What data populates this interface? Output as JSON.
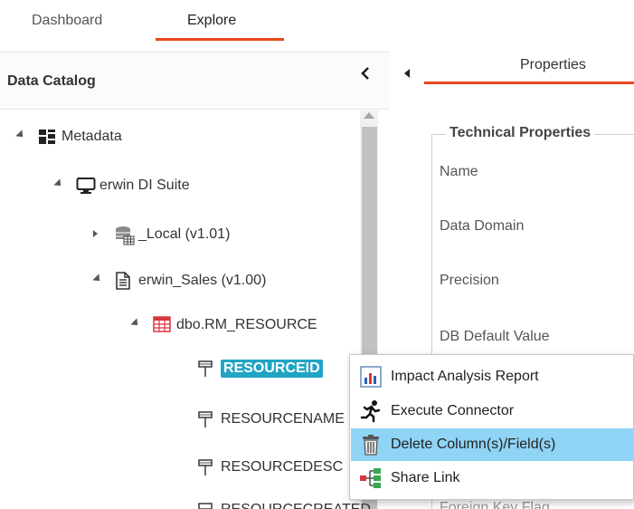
{
  "top_tabs": {
    "dashboard": "Dashboard",
    "explore": "Explore",
    "active": "Explore",
    "accent_color": "#e8471d"
  },
  "catalog": {
    "title": "Data Catalog",
    "collapse_icon": "chevron-left-icon"
  },
  "tree": {
    "metadata": "Metadata",
    "suite": "erwin DI Suite",
    "local": "_Local (v1.01)",
    "sales": "erwin_Sales (v1.00)",
    "table": "dbo.RM_RESOURCE",
    "columns": [
      "RESOURCEID",
      "RESOURCENAME",
      "RESOURCEDESC",
      "RESOURCECREATED"
    ],
    "selected": "RESOURCEID",
    "selected_color": "#1fa4c4"
  },
  "properties": {
    "tab": "Properties",
    "expand_icon": "caret-left-icon",
    "section_title": "Technical Properties",
    "fields": [
      "Name",
      "Data Domain",
      "Precision",
      "DB Default Value",
      "Foreign Key Flag"
    ]
  },
  "context_menu": {
    "items": [
      {
        "label": "Impact Analysis Report",
        "icon": "bar-chart-report-icon"
      },
      {
        "label": "Execute Connector",
        "icon": "running-man-icon"
      },
      {
        "label": "Delete Column(s)/Field(s)",
        "icon": "trash-icon"
      },
      {
        "label": "Share Link",
        "icon": "hierarchy-share-icon"
      }
    ],
    "highlighted": "Delete Column(s)/Field(s)",
    "highlight_color": "#8fd3f5"
  }
}
